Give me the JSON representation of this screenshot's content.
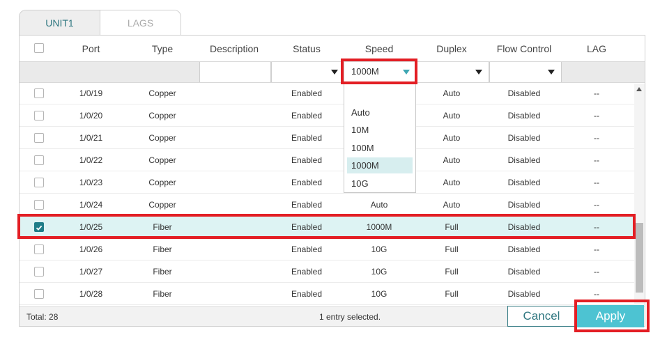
{
  "tabs": [
    {
      "label": "UNIT1"
    },
    {
      "label": "LAGS"
    }
  ],
  "columns": {
    "port": "Port",
    "type": "Type",
    "description": "Description",
    "status": "Status",
    "speed": "Speed",
    "duplex": "Duplex",
    "flow_control": "Flow Control",
    "lag": "LAG"
  },
  "filters": {
    "speed_value": "1000M"
  },
  "speed_options": [
    "Auto",
    "10M",
    "100M",
    "1000M",
    "10G"
  ],
  "speed_options_selected": "1000M",
  "rows": [
    {
      "port": "1/0/19",
      "type": "Copper",
      "status": "Enabled",
      "speed": "",
      "duplex": "Auto",
      "flow": "Disabled",
      "lag": "--",
      "checked": false
    },
    {
      "port": "1/0/20",
      "type": "Copper",
      "status": "Enabled",
      "speed": "",
      "duplex": "Auto",
      "flow": "Disabled",
      "lag": "--",
      "checked": false
    },
    {
      "port": "1/0/21",
      "type": "Copper",
      "status": "Enabled",
      "speed": "",
      "duplex": "Auto",
      "flow": "Disabled",
      "lag": "--",
      "checked": false
    },
    {
      "port": "1/0/22",
      "type": "Copper",
      "status": "Enabled",
      "speed": "",
      "duplex": "Auto",
      "flow": "Disabled",
      "lag": "--",
      "checked": false
    },
    {
      "port": "1/0/23",
      "type": "Copper",
      "status": "Enabled",
      "speed": "",
      "duplex": "Auto",
      "flow": "Disabled",
      "lag": "--",
      "checked": false
    },
    {
      "port": "1/0/24",
      "type": "Copper",
      "status": "Enabled",
      "speed": "Auto",
      "duplex": "Auto",
      "flow": "Disabled",
      "lag": "--",
      "checked": false
    },
    {
      "port": "1/0/25",
      "type": "Fiber",
      "status": "Enabled",
      "speed": "1000M",
      "duplex": "Full",
      "flow": "Disabled",
      "lag": "--",
      "checked": true
    },
    {
      "port": "1/0/26",
      "type": "Fiber",
      "status": "Enabled",
      "speed": "10G",
      "duplex": "Full",
      "flow": "Disabled",
      "lag": "--",
      "checked": false
    },
    {
      "port": "1/0/27",
      "type": "Fiber",
      "status": "Enabled",
      "speed": "10G",
      "duplex": "Full",
      "flow": "Disabled",
      "lag": "--",
      "checked": false
    },
    {
      "port": "1/0/28",
      "type": "Fiber",
      "status": "Enabled",
      "speed": "10G",
      "duplex": "Full",
      "flow": "Disabled",
      "lag": "--",
      "checked": false
    }
  ],
  "footer": {
    "total": "Total: 28",
    "selection": "1 entry selected."
  },
  "buttons": {
    "cancel": "Cancel",
    "apply": "Apply"
  },
  "colors": {
    "accent": "#1e7d88",
    "apply_bg": "#4dc3d2",
    "selected_row": "#ddf3f3",
    "highlight": "#e31e24"
  }
}
